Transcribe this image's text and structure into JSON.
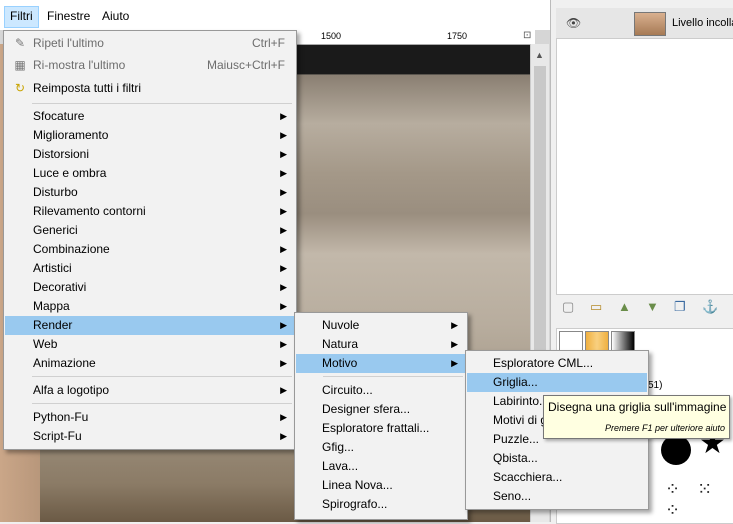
{
  "menubar": {
    "items": [
      "Filtri",
      "Finestre",
      "Aiuto"
    ]
  },
  "ruler": {
    "ticks": [
      "1500",
      "1750"
    ]
  },
  "filters_menu": {
    "top_items": [
      {
        "label": "Ripeti l'ultimo",
        "accel": "Ctrl+F",
        "icon": "repeat-icon",
        "disabled": true
      },
      {
        "label": "Ri-mostra l'ultimo",
        "accel": "Maiusc+Ctrl+F",
        "icon": "reshow-icon",
        "disabled": true
      },
      {
        "label": "Reimposta tutti i filtri",
        "accel": "",
        "icon": "reset-icon",
        "disabled": false
      }
    ],
    "categories": [
      "Sfocature",
      "Miglioramento",
      "Distorsioni",
      "Luce e ombra",
      "Disturbo",
      "Rilevamento contorni",
      "Generici",
      "Combinazione",
      "Artistici",
      "Decorativi",
      "Mappa",
      "Render",
      "Web",
      "Animazione"
    ],
    "extra": [
      "Alfa a logotipo"
    ],
    "scripts": [
      "Python-Fu",
      "Script-Fu"
    ],
    "selected": "Render"
  },
  "render_menu": {
    "submenus": [
      "Nuvole",
      "Natura",
      "Motivo"
    ],
    "items": [
      "Circuito...",
      "Designer sfera...",
      "Esploratore frattali...",
      "Gfig...",
      "Lava...",
      "Linea Nova...",
      "Spirografo..."
    ],
    "selected": "Motivo"
  },
  "pattern_menu": {
    "items": [
      "Esploratore CML...",
      "Griglia...",
      "Labirinto...",
      "Motivi di g",
      "Puzzle...",
      "Qbista...",
      "Scacchiera...",
      "Seno..."
    ],
    "selected": "Griglia..."
  },
  "tooltip": {
    "text": "Disegna una griglia sull'immagine",
    "hint": "Premere F1 per ulteriore aiuto"
  },
  "layers": {
    "layer_name": "Livello incollat"
  },
  "brushes": {
    "info": "51)"
  },
  "colors": {
    "highlight": "#99c9ef",
    "menu_bg": "#f2f2f2"
  }
}
